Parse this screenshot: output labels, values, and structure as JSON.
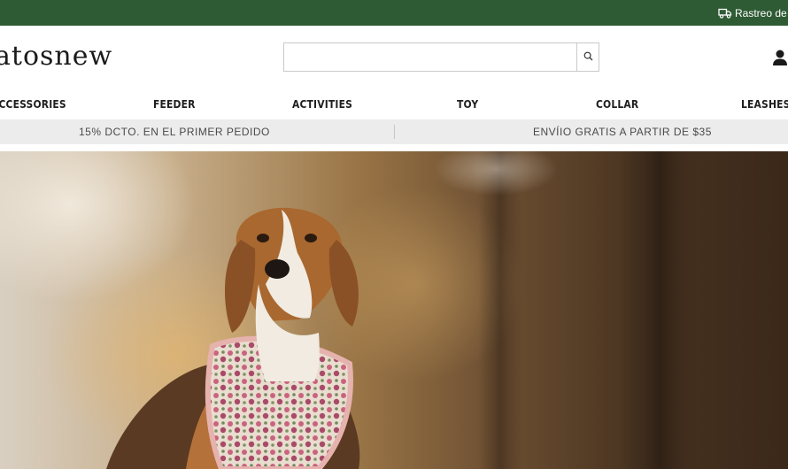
{
  "topbar": {
    "tracking_label": "Rastreo de"
  },
  "header": {
    "logo_text": "atosnew",
    "search_placeholder": ""
  },
  "nav": {
    "items": [
      {
        "label": "ACCESSORIES"
      },
      {
        "label": "FEEDER"
      },
      {
        "label": "ACTIVITIES"
      },
      {
        "label": "TOY"
      },
      {
        "label": "COLLAR"
      },
      {
        "label": "LEASHES"
      }
    ]
  },
  "promo": {
    "left": "15% DCTO. EN EL PRIMER PEDIDO",
    "right": "ENVÍIO GRATIS A PARTIR DE $35"
  },
  "colors": {
    "topbar": "#2e5a34",
    "promo_bg": "#ececec"
  },
  "icons": {
    "tracking": "truck-icon",
    "search": "search-icon",
    "account": "user-icon"
  }
}
